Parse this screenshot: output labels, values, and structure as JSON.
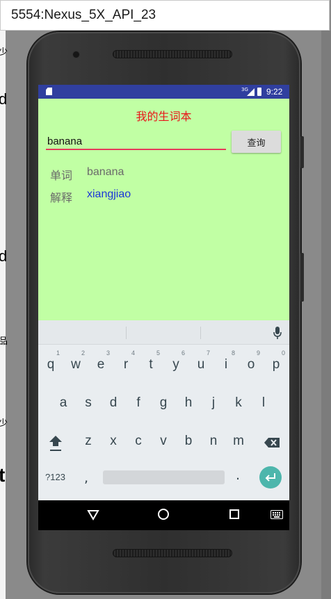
{
  "window": {
    "title": "5554:Nexus_5X_API_23"
  },
  "desktop": {
    "edge_glyphs": [
      "少",
      "d",
      "d",
      "品",
      "少",
      "t"
    ]
  },
  "status_bar": {
    "network": "3G",
    "time": "9:22",
    "color": "#303f9f"
  },
  "app": {
    "title": "我的生词本",
    "search": {
      "value": "banana",
      "placeholder": ""
    },
    "query_button": "查询",
    "word_label": "单词",
    "word_value": "banana",
    "meaning_label": "解释",
    "meaning_value": "xiangjiao",
    "background": "#c1ffa4",
    "title_color": "#e8161a",
    "meaning_color": "#1a35d8"
  },
  "keyboard": {
    "row1": [
      "q",
      "w",
      "e",
      "r",
      "t",
      "y",
      "u",
      "i",
      "o",
      "p"
    ],
    "row1_hints": [
      "1",
      "2",
      "3",
      "4",
      "5",
      "6",
      "7",
      "8",
      "9",
      "0"
    ],
    "row2": [
      "a",
      "s",
      "d",
      "f",
      "g",
      "h",
      "j",
      "k",
      "l"
    ],
    "row3": [
      "z",
      "x",
      "c",
      "v",
      "b",
      "n",
      "m"
    ],
    "symbols_key": "?123",
    "comma": ",",
    "period": ".",
    "icons": [
      "shift-icon",
      "backspace-icon",
      "enter-icon",
      "microphone-icon"
    ]
  },
  "navigation": {
    "icons": [
      "back-icon",
      "home-icon",
      "recents-icon",
      "keyboard-switch-icon"
    ]
  }
}
